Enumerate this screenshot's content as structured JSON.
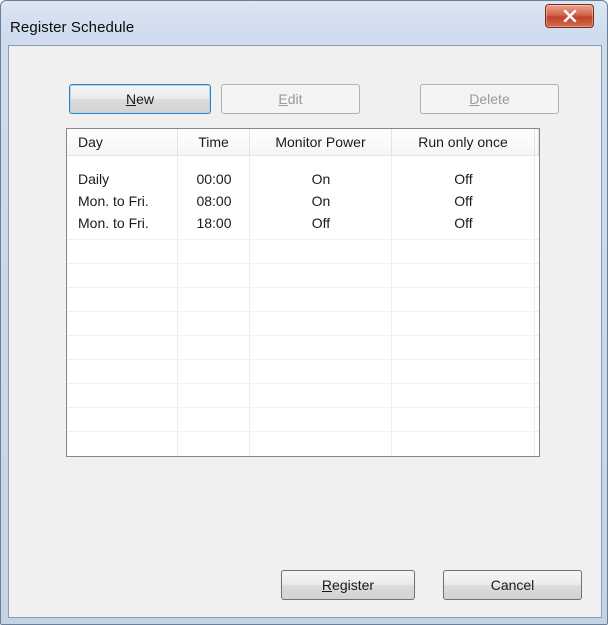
{
  "window": {
    "title": "Register Schedule",
    "close_icon": "close-icon"
  },
  "toolbar": {
    "new_label_mnemonic": "N",
    "new_label_rest": "ew",
    "edit_label_mnemonic": "E",
    "edit_label_rest": "dit",
    "delete_label_mnemonic": "D",
    "delete_label_rest": "elete"
  },
  "schedule_table": {
    "columns": [
      "Day",
      "Time",
      "Monitor Power",
      "Run only once"
    ],
    "rows": [
      [
        "Daily",
        "00:00",
        "On",
        "Off"
      ],
      [
        "Mon. to Fri.",
        "08:00",
        "On",
        "Off"
      ],
      [
        "Mon. to Fri.",
        "18:00",
        "Off",
        "Off"
      ]
    ]
  },
  "footer": {
    "register_label_mnemonic": "R",
    "register_label_rest": "egister",
    "cancel_label": "Cancel"
  }
}
